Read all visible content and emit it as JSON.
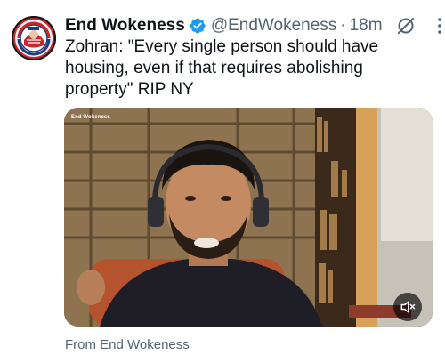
{
  "tweet": {
    "display_name": "End Wokeness",
    "handle": "@EndWokeness",
    "separator": "·",
    "time": "18m",
    "text": "Zohran: \"Every single person should have housing, even if that requires abolishing property\" RIP NY",
    "source": "From End Wokeness",
    "media": {
      "overlay_label": "End Wokeness",
      "sound_state": "muted"
    }
  },
  "icons": {
    "verified": "verified-badge-icon",
    "grok": "grok-icon",
    "more": "more-options-icon",
    "mute": "muted-speaker-icon"
  },
  "colors": {
    "verified": "#1d9bf0",
    "text_primary": "#0f1419",
    "text_secondary": "#536471"
  }
}
